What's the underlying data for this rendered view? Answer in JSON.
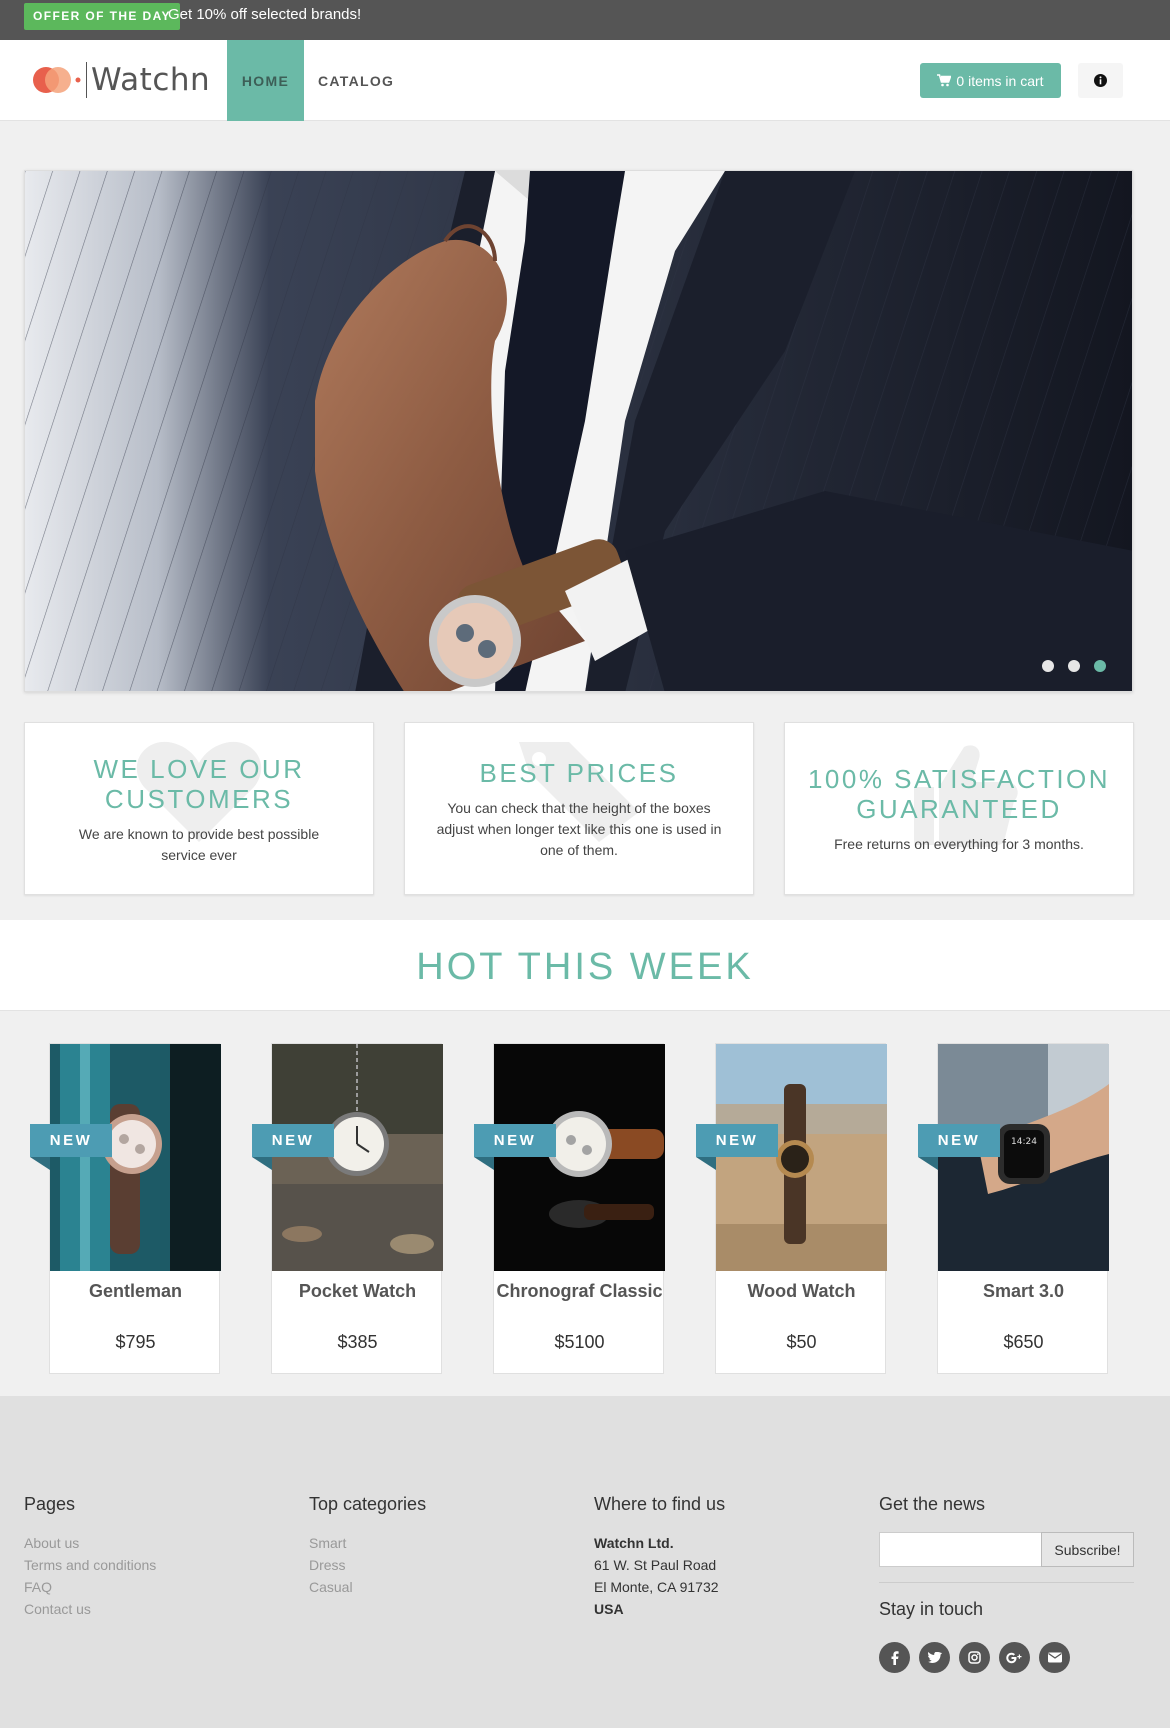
{
  "topbar": {
    "badge": "OFFER OF THE DAY",
    "text": "Get 10% off selected brands!"
  },
  "brand": {
    "name": "Watchn",
    "accent": "#6bbaa7"
  },
  "nav": {
    "home": "HOME",
    "catalog": "CATALOG",
    "cart": "0 items in cart",
    "info_icon": "info-circle-icon"
  },
  "hero": {
    "slides": 3,
    "active_slide": 3
  },
  "features": [
    {
      "title": "WE LOVE OUR CUSTOMERS",
      "text": "We are known to provide best possible service ever",
      "icon": "heart-icon"
    },
    {
      "title": "BEST PRICES",
      "text": "You can check that the height of the boxes adjust when longer text like this one is used in one of them.",
      "icon": "tags-icon"
    },
    {
      "title": "100% SATISFACTION GUARANTEED",
      "text": "Free returns on everything for 3 months.",
      "icon": "thumbs-up-icon"
    }
  ],
  "hot": {
    "title": "HOT THIS WEEK",
    "ribbon": "NEW",
    "products": [
      {
        "name": "Gentleman",
        "price": "$795"
      },
      {
        "name": "Pocket Watch",
        "price": "$385"
      },
      {
        "name": "Chronograf Classic",
        "price": "$5100"
      },
      {
        "name": "Wood Watch",
        "price": "$50"
      },
      {
        "name": "Smart 3.0",
        "price": "$650"
      }
    ]
  },
  "footer": {
    "pages": {
      "title": "Pages",
      "links": [
        "About us",
        "Terms and conditions",
        "FAQ",
        "Contact us"
      ]
    },
    "categories": {
      "title": "Top categories",
      "links": [
        "Smart",
        "Dress",
        "Casual"
      ]
    },
    "address": {
      "title": "Where to find us",
      "company": "Watchn Ltd.",
      "street": "61 W. St Paul Road",
      "city": "El Monte, CA 91732",
      "country": "USA"
    },
    "news": {
      "title": "Get the news",
      "placeholder": "",
      "button": "Subscribe!",
      "stay": "Stay in touch"
    },
    "socials": [
      "facebook-icon",
      "twitter-icon",
      "instagram-icon",
      "google-plus-icon",
      "envelope-icon"
    ]
  }
}
